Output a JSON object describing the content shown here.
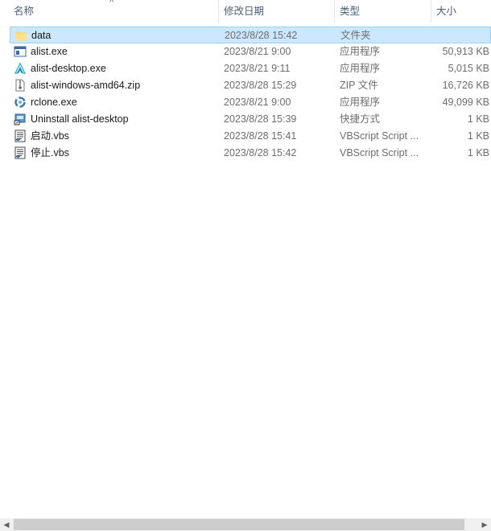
{
  "columns": {
    "name": "名称",
    "date": "修改日期",
    "type": "类型",
    "size": "大小"
  },
  "files": [
    {
      "name": "data",
      "date": "2023/8/28 15:42",
      "type": "文件夹",
      "size": "",
      "icon": "folder-icon",
      "selected": true
    },
    {
      "name": "alist.exe",
      "date": "2023/8/21 9:00",
      "type": "应用程序",
      "size": "50,913 KB",
      "icon": "exe-window-icon"
    },
    {
      "name": "alist-desktop.exe",
      "date": "2023/8/21 9:11",
      "type": "应用程序",
      "size": "5,015 KB",
      "icon": "alist-logo-icon"
    },
    {
      "name": "alist-windows-amd64.zip",
      "date": "2023/8/28 15:29",
      "type": "ZIP 文件",
      "size": "16,726 KB",
      "icon": "zip-file-icon"
    },
    {
      "name": "rclone.exe",
      "date": "2023/8/21 9:00",
      "type": "应用程序",
      "size": "49,099 KB",
      "icon": "rclone-logo-icon"
    },
    {
      "name": "Uninstall alist-desktop",
      "date": "2023/8/28 15:39",
      "type": "快捷方式",
      "size": "1 KB",
      "icon": "uninstall-shortcut-icon"
    },
    {
      "name": "启动.vbs",
      "date": "2023/8/28 15:41",
      "type": "VBScript Script ...",
      "size": "1 KB",
      "icon": "vbs-script-icon"
    },
    {
      "name": "停止.vbs",
      "date": "2023/8/28 15:42",
      "type": "VBScript Script ...",
      "size": "1 KB",
      "icon": "vbs-script-icon"
    }
  ],
  "scrollbar": {
    "left_arrow": "◀",
    "right_arrow": "▶"
  }
}
